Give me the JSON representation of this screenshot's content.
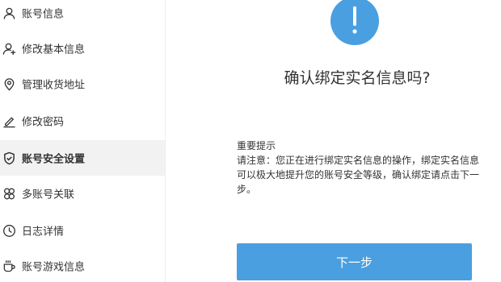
{
  "sidebar": {
    "items": [
      {
        "label": "账号信息",
        "icon": "user-icon",
        "active": false
      },
      {
        "label": "修改基本信息",
        "icon": "user-add-icon",
        "active": false
      },
      {
        "label": "管理收货地址",
        "icon": "location-pin-icon",
        "active": false
      },
      {
        "label": "修改密码",
        "icon": "pencil-icon",
        "active": false
      },
      {
        "label": "账号安全设置",
        "icon": "shield-check-icon",
        "active": true
      },
      {
        "label": "多账号关联",
        "icon": "link-accounts-icon",
        "active": false
      },
      {
        "label": "日志详情",
        "icon": "clock-icon",
        "active": false
      },
      {
        "label": "账号游戏信息",
        "icon": "cup-icon",
        "active": false
      }
    ]
  },
  "main": {
    "alert_icon": "exclamation-icon",
    "title": "确认绑定实名信息吗?",
    "notice_heading": "重要提示",
    "notice_body": "请注意：您正在进行绑定实名信息的操作，绑定实名信息可以极大地提升您的账号安全等级，确认绑定请点击下一步。",
    "next_button_label": "下一步"
  },
  "colors": {
    "accent": "#4a9fe0",
    "active_item_bg": "#f2f2f2",
    "text": "#333333"
  }
}
